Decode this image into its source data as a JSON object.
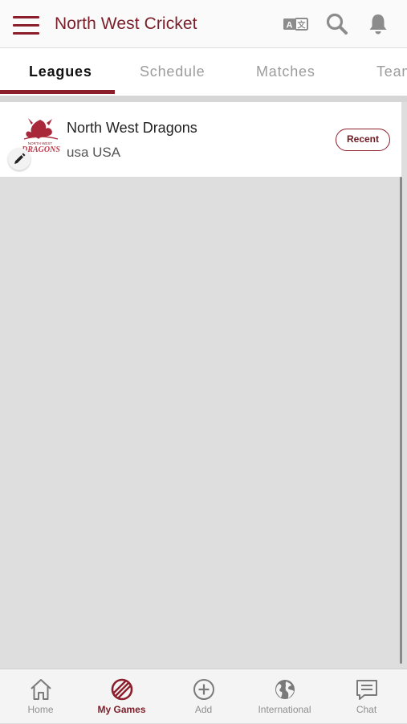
{
  "app": {
    "title": "North West Cricket"
  },
  "header_actions": {
    "translate_glyph": "A",
    "translate_glyph2": "文"
  },
  "tabs": [
    {
      "label": "Leagues",
      "active": true
    },
    {
      "label": "Schedule",
      "active": false
    },
    {
      "label": "Matches",
      "active": false
    },
    {
      "label": "Teams",
      "active": false
    }
  ],
  "leagues": [
    {
      "name": "North West Dragons",
      "country": "usa USA",
      "logo_text": "DRAGONS",
      "logo_subtext": "NORTH WEST",
      "action_label": "Recent"
    }
  ],
  "bottom_nav": [
    {
      "label": "Home",
      "icon": "home-icon",
      "active": false
    },
    {
      "label": "My Games",
      "icon": "cricket-ball-icon",
      "active": true
    },
    {
      "label": "Add",
      "icon": "plus-circle-icon",
      "active": false
    },
    {
      "label": "International",
      "icon": "globe-icon",
      "active": false
    },
    {
      "label": "Chat",
      "icon": "chat-icon",
      "active": false
    }
  ],
  "colors": {
    "accent": "#8a1f2b",
    "background": "#dedede",
    "inactive_text": "#9c9c9c"
  }
}
